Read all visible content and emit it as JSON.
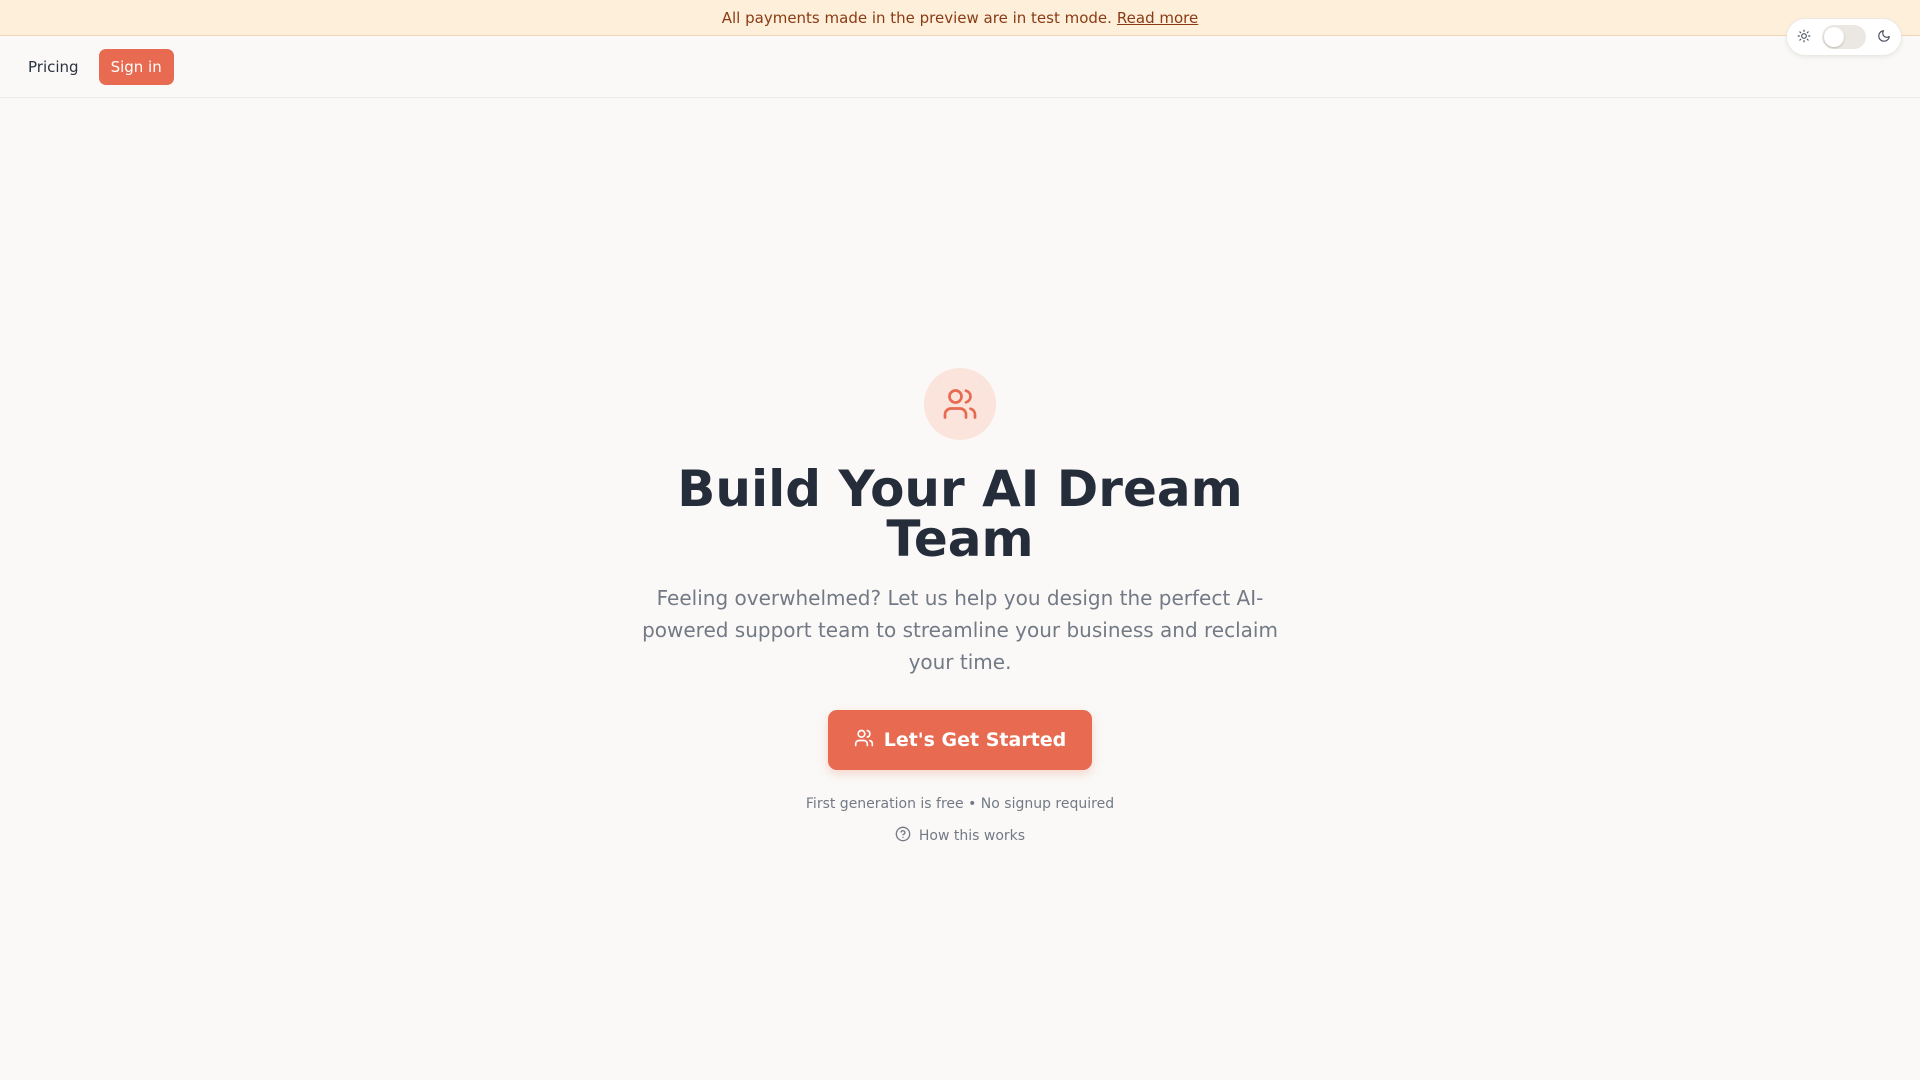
{
  "banner": {
    "text": "All payments made in the preview are in test mode.",
    "link": "Read more"
  },
  "theme_toggle": {
    "light_icon": "sun-icon",
    "dark_icon": "moon-icon",
    "state": "light"
  },
  "nav": {
    "pricing": "Pricing",
    "sign_in": "Sign in"
  },
  "hero": {
    "icon": "users-icon",
    "title": "Build Your AI Dream Team",
    "subtitle": "Feeling overwhelmed? Let us help you design the perfect AI-powered support team to streamline your business and reclaim your time.",
    "cta_label": "Let's Get Started",
    "cta_icon": "users-icon",
    "note": "First generation is free • No signup required",
    "how_label": "How this works",
    "how_icon": "help-circle-icon"
  },
  "colors": {
    "accent": "#e86a50",
    "banner_bg": "#fdefd9",
    "page_bg": "#faf9f7",
    "heading": "#252d3b",
    "muted": "#737a86"
  }
}
